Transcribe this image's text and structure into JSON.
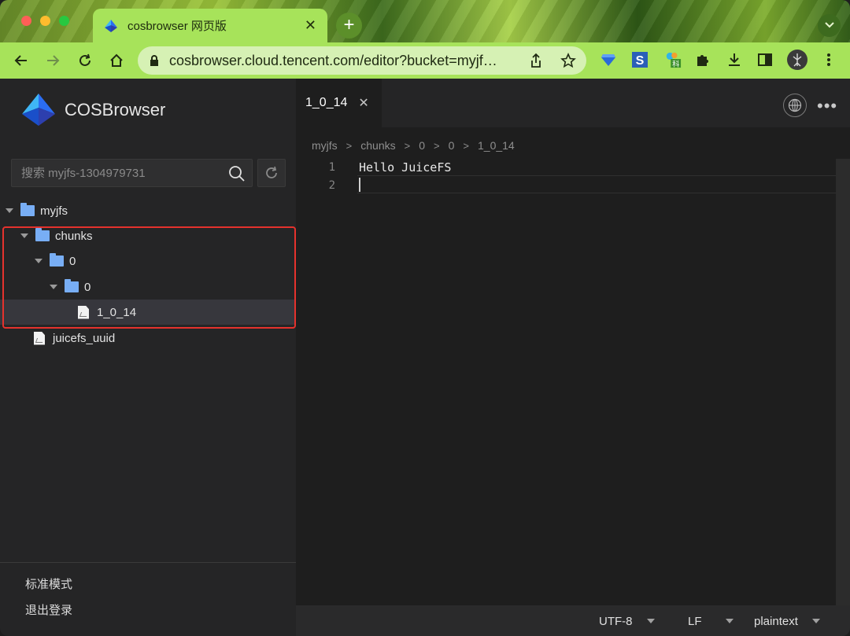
{
  "browser": {
    "tab_title": "cosbrowser 网页版",
    "tab_close": "✕",
    "new_tab": "+",
    "url": "cosbrowser.cloud.tencent.com/editor?bucket=myjf…",
    "ext_badge": "科"
  },
  "sidebar": {
    "brand": "COSBrowser",
    "search_placeholder": "搜索 myjfs-1304979731",
    "tree": [
      {
        "label": "myjfs",
        "type": "folder"
      },
      {
        "label": "chunks",
        "type": "folder"
      },
      {
        "label": "0",
        "type": "folder"
      },
      {
        "label": "0",
        "type": "folder"
      },
      {
        "label": "1_0_14",
        "type": "file",
        "selected": true
      },
      {
        "label": "juicefs_uuid",
        "type": "file"
      }
    ],
    "footer": {
      "mode": "标准模式",
      "logout": "退出登录"
    }
  },
  "editor": {
    "tab_label": "1_0_14",
    "tab_close": "✕",
    "more": "•••",
    "breadcrumb": [
      "myjfs",
      "chunks",
      "0",
      "0",
      "1_0_14"
    ],
    "crumb_sep": ">",
    "line_numbers": [
      "1",
      "2"
    ],
    "lines": [
      "Hello JuiceFS",
      ""
    ],
    "status": {
      "encoding": "UTF-8",
      "eol": "LF",
      "language": "plaintext"
    }
  },
  "colors": {
    "accent_green": "#a7e35a",
    "highlight_red": "#e5322d",
    "folder_blue": "#78aef5"
  }
}
